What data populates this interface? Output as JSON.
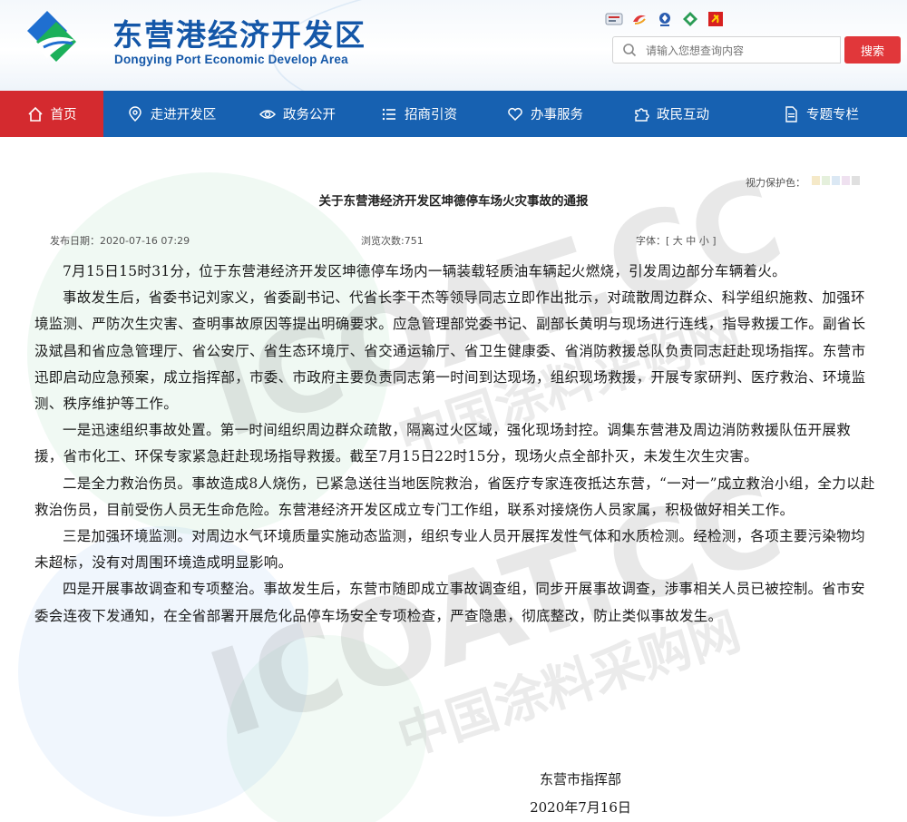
{
  "site": {
    "name_cn": "东营港经济开发区",
    "name_en": "Dongying Port Economic Develop Area"
  },
  "search": {
    "placeholder": "请输入您想查询内容",
    "button_label": "搜索"
  },
  "nav": {
    "items": [
      {
        "label": "首页",
        "icon": "home-icon"
      },
      {
        "label": "走进开发区",
        "icon": "map-pin-icon"
      },
      {
        "label": "政务公开",
        "icon": "eye-icon"
      },
      {
        "label": "招商引资",
        "icon": "list-icon"
      },
      {
        "label": "办事服务",
        "icon": "heart-icon"
      },
      {
        "label": "政民互动",
        "icon": "puzzle-icon"
      },
      {
        "label": "专题专栏",
        "icon": "document-icon"
      }
    ]
  },
  "article": {
    "vision_label": "视力保护色：",
    "title": "关于东营港经济开发区坤德停车场火灾事故的通报",
    "published": "发布日期：2020-07-16 07:29",
    "views": "浏览次数:751",
    "font_size": "字体：[ 大 中 小 ]",
    "paragraphs": [
      "7月15日15时31分，位于东营港经济开发区坤德停车场内一辆装载轻质油车辆起火燃烧，引发周边部分车辆着火。",
      "事故发生后，省委书记刘家义，省委副书记、代省长李干杰等领导同志立即作出批示，对疏散周边群众、科学组织施救、加强环境监测、严防次生灾害、查明事故原因等提出明确要求。应急管理部党委书记、副部长黄明与现场进行连线，指导救援工作。副省长汲斌昌和省应急管理厅、省公安厅、省生态环境厅、省交通运输厅、省卫生健康委、省消防救援总队负责同志赶赴现场指挥。东营市迅即启动应急预案，成立指挥部，市委、市政府主要负责同志第一时间到达现场，组织现场救援，开展专家研判、医疗救治、环境监测、秩序维护等工作。",
      "一是迅速组织事故处置。第一时间组织周边群众疏散，隔离过火区域，强化现场封控。调集东营港及周边消防救援队伍开展救援，省市化工、环保专家紧急赶赴现场指导救援。截至7月15日22时15分，现场火点全部扑灭，未发生次生灾害。",
      "二是全力救治伤员。事故造成8人烧伤，已紧急送往当地医院救治，省医疗专家连夜抵达东营，“一对一”成立救治小组，全力以赴救治伤员，目前受伤人员无生命危险。东营港经济开发区成立专门工作组，联系对接烧伤人员家属，积极做好相关工作。",
      "三是加强环境监测。对周边水气环境质量实施动态监测，组织专业人员开展挥发性气体和水质检测。经检测，各项主要污染物均未超标，没有对周围环境造成明显影响。",
      "四是开展事故调查和专项整治。事故发生后，东营市随即成立事故调查组，同步开展事故调查，涉事相关人员已被控制。省市安委会连夜下发通知，在全省部署开展危化品停车场安全专项检查，严查隐患，彻底整改，防止类似事故发生。"
    ],
    "signature": "东营市指挥部",
    "date": "2020年7月16日"
  },
  "watermark": {
    "brand": "ICOAT.CC",
    "tagline": "中国涂料采购网"
  },
  "colors": {
    "brand_blue": "#1457a8",
    "nav_blue": "#1761b1",
    "active_red": "#d42a2f",
    "search_red": "#e1373a"
  },
  "vision_swatches": [
    "#f5e9c8",
    "#e5f0dc",
    "#dbe8f4",
    "#efe1f0",
    "#e0e0e0"
  ]
}
